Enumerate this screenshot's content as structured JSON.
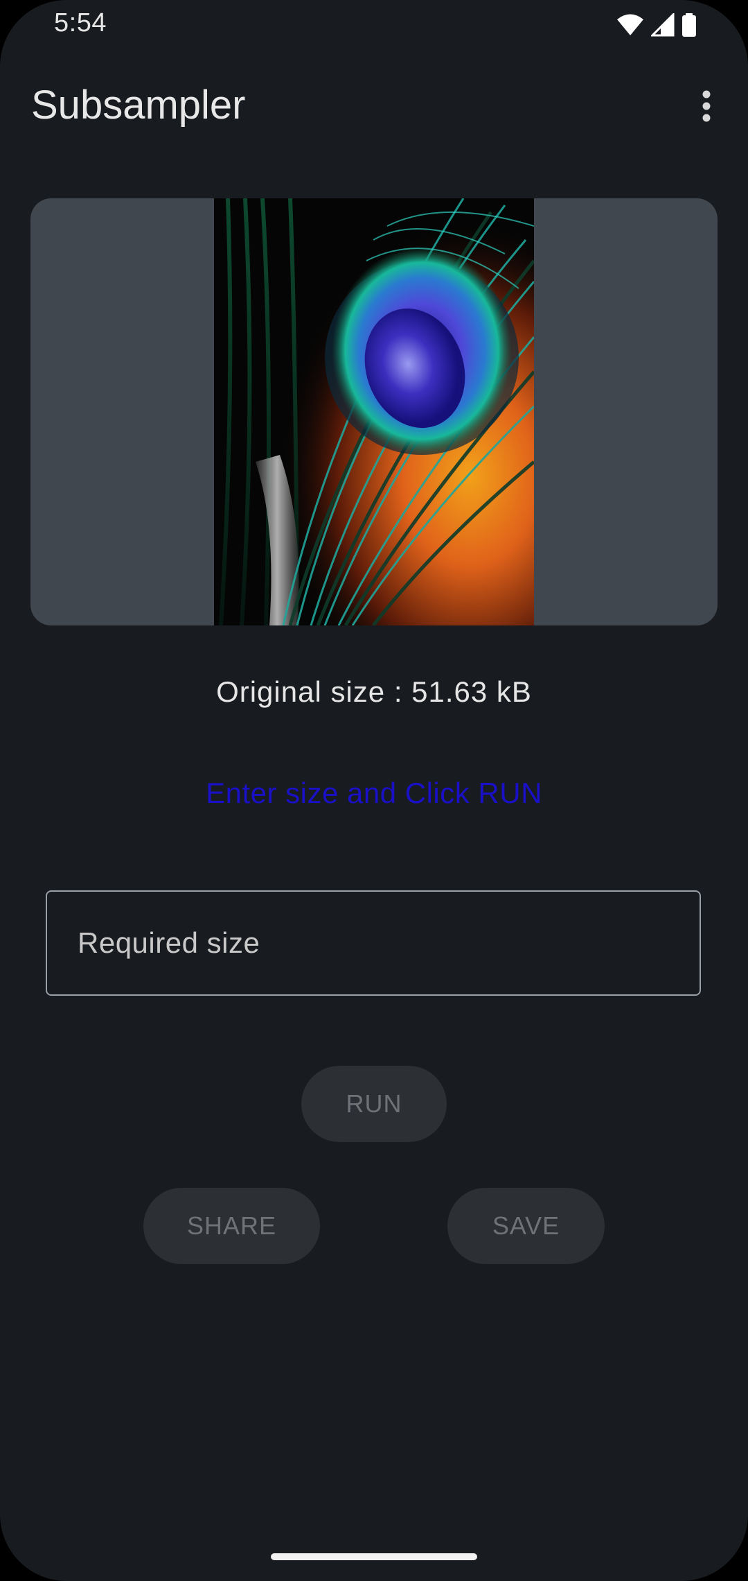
{
  "status_bar": {
    "time": "5:54",
    "icons": [
      "wifi-icon",
      "signal-icon",
      "battery-icon"
    ]
  },
  "app_bar": {
    "title": "Subsampler",
    "overflow_icon": "more-vert-icon"
  },
  "preview": {
    "image_description": "peacock-feather"
  },
  "info": {
    "original_size_text": "Original size : 51.63 kB",
    "instruction_text": "Enter size and Click RUN"
  },
  "size_input": {
    "placeholder": "Required size",
    "value": ""
  },
  "buttons": {
    "run_label": "RUN",
    "share_label": "SHARE",
    "save_label": "SAVE"
  },
  "colors": {
    "background": "#181b1f",
    "image_card": "#41474e",
    "instruction": "#1a10c8",
    "button_bg": "#2c2f33",
    "button_text": "#6f7378"
  }
}
